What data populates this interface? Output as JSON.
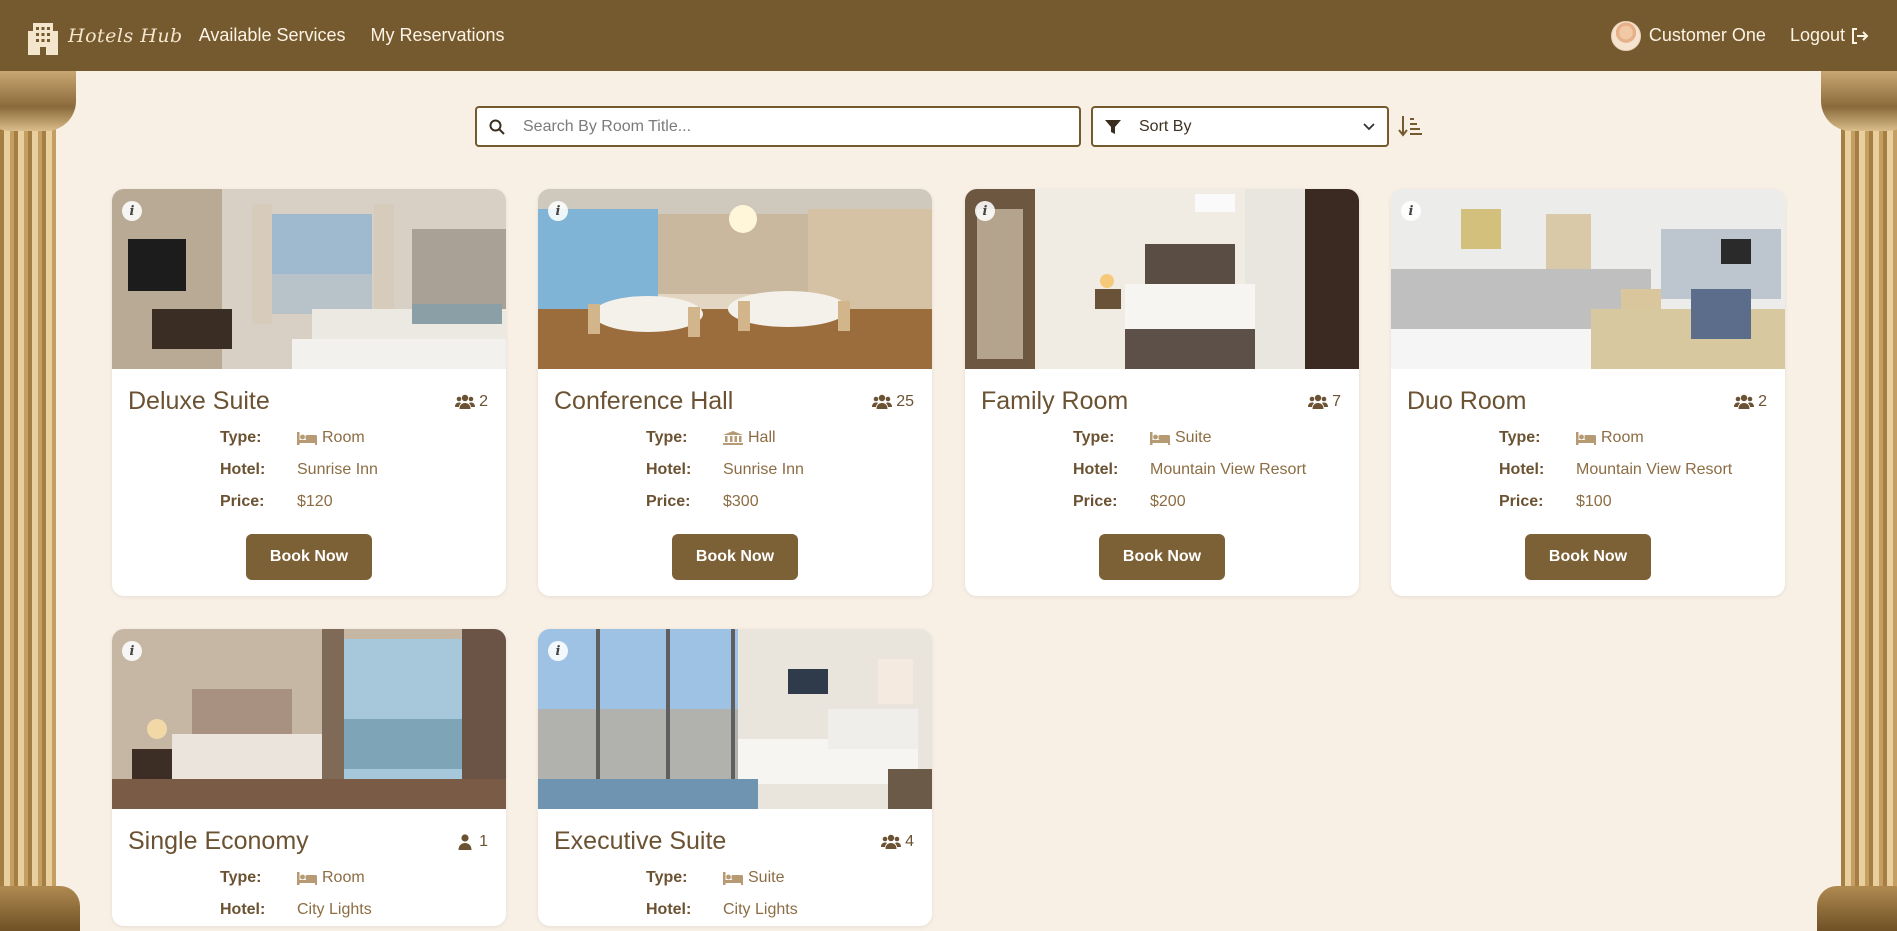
{
  "header": {
    "brand": "Hotels Hub",
    "nav": [
      "Available Services",
      "My Reservations"
    ],
    "user_name": "Customer One",
    "logout": "Logout"
  },
  "toolbar": {
    "search_placeholder": "Search By Room Title...",
    "sort_label": "Sort By"
  },
  "labels": {
    "type": "Type:",
    "hotel": "Hotel:",
    "price": "Price:",
    "book": "Book Now"
  },
  "rooms": [
    {
      "title": "Deluxe Suite",
      "capacity": "2",
      "type": "Room",
      "type_icon": "bed-icon",
      "hotel": "Sunrise Inn",
      "price": "$120"
    },
    {
      "title": "Conference Hall",
      "capacity": "25",
      "type": "Hall",
      "type_icon": "building-columns-icon",
      "hotel": "Sunrise Inn",
      "price": "$300"
    },
    {
      "title": "Family Room",
      "capacity": "7",
      "type": "Suite",
      "type_icon": "bed-icon",
      "hotel": "Mountain View Resort",
      "price": "$200"
    },
    {
      "title": "Duo Room",
      "capacity": "2",
      "type": "Room",
      "type_icon": "bed-icon",
      "hotel": "Mountain View Resort",
      "price": "$100"
    },
    {
      "title": "Single Economy",
      "capacity": "1",
      "type": "Room",
      "type_icon": "bed-icon",
      "hotel": "City Lights",
      "price": ""
    },
    {
      "title": "Executive Suite",
      "capacity": "4",
      "type": "Suite",
      "type_icon": "bed-icon",
      "hotel": "City Lights",
      "price": ""
    }
  ],
  "colors": {
    "header": "#765a2f",
    "background": "#f8f0e5",
    "button": "#7c6036",
    "text": "#6b5232"
  }
}
